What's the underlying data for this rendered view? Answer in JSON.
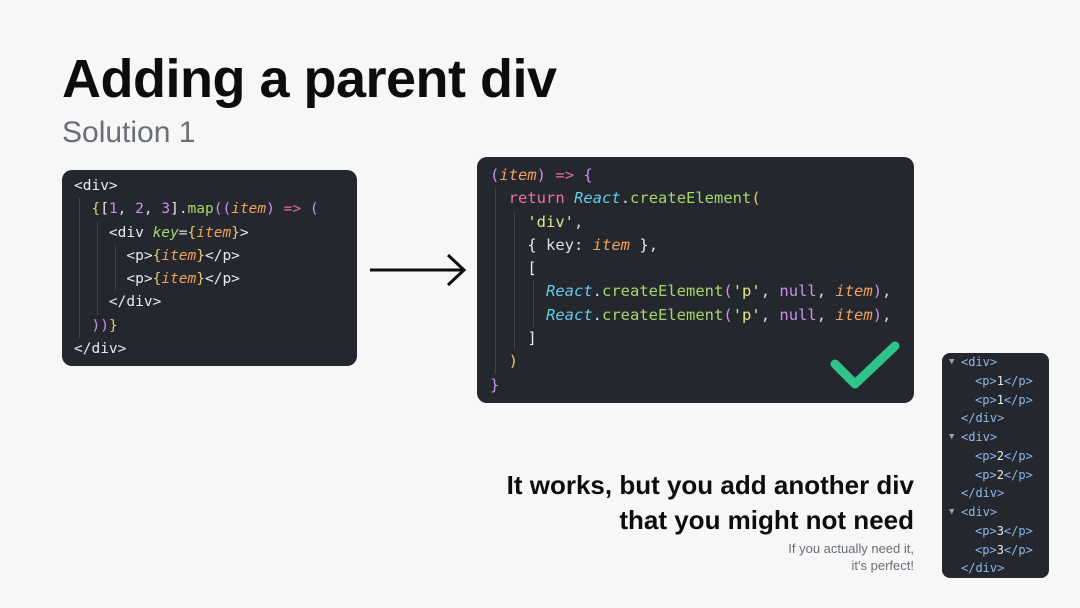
{
  "slide": {
    "title": "Adding a parent div",
    "subtitle": "Solution 1"
  },
  "code_jsx": {
    "lines": [
      "<div>",
      "  {[1, 2, 3].map((item) => (",
      "    <div key={item}>",
      "      <p>{item}</p>",
      "      <p>{item}</p>",
      "    </div>",
      "  ))}",
      "</div>"
    ]
  },
  "code_create_element": {
    "lines": [
      "(item) => {",
      "  return React.createElement(",
      "    'div',",
      "    { key: item },",
      "    [",
      "      React.createElement('p', null, item),",
      "      React.createElement('p', null, item),",
      "    ]",
      "  )",
      "}"
    ]
  },
  "icons": {
    "arrow": "arrow-right-icon",
    "check": "checkmark-icon",
    "check_color": "#2fc48a"
  },
  "caption": {
    "line1": "It works, but you add another div",
    "line2": "that you might not need",
    "note_line1": "If you actually need it,",
    "note_line2": "it's perfect!"
  },
  "dom_tree": {
    "rows": [
      {
        "open": "<div>"
      },
      {
        "p": "1"
      },
      {
        "p": "1"
      },
      {
        "close": "</div>"
      },
      {
        "open": "<div>"
      },
      {
        "p": "2"
      },
      {
        "p": "2"
      },
      {
        "close": "</div>"
      },
      {
        "open": "<div>"
      },
      {
        "p": "3"
      },
      {
        "p": "3"
      },
      {
        "close": "</div>"
      }
    ],
    "p_open": "<p>",
    "p_close": "</p>"
  }
}
